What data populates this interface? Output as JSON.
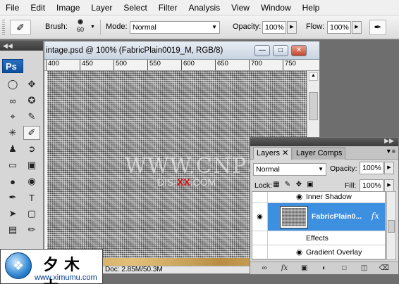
{
  "menu": [
    "File",
    "Edit",
    "Image",
    "Layer",
    "Select",
    "Filter",
    "Analysis",
    "View",
    "Window",
    "Help"
  ],
  "options": {
    "brush_label": "Brush:",
    "brush_size": "60",
    "mode_label": "Mode:",
    "mode_value": "Normal",
    "opacity_label": "Opacity:",
    "opacity_value": "100%",
    "flow_label": "Flow:",
    "flow_value": "100%"
  },
  "tools_panel": {
    "logo": "Ps"
  },
  "document": {
    "title": "intage.psd @ 100% (FabricPlain0019_M, RGB/8)",
    "ruler_ticks": [
      "400",
      "450",
      "500",
      "550",
      "600",
      "650",
      "700",
      "750"
    ],
    "status": "Doc: 2.85M/50.3M",
    "watermark_line1": "WWW.CNPS.COM",
    "watermark_line2_a": "DIS-",
    "watermark_line2_b": "XX",
    "watermark_line2_c": ".COM"
  },
  "layers_panel": {
    "tabs": [
      "Layers",
      "Layer Comps"
    ],
    "blend_mode": "Normal",
    "opacity_label": "Opacity:",
    "opacity_value": "100%",
    "lock_label": "Lock:",
    "fill_label": "Fill:",
    "fill_value": "100%",
    "rows": {
      "inner_shadow": "Inner Shadow",
      "layer_name": "FabricPlain0...",
      "effects": "Effects",
      "gradient_overlay": "Gradient Overlay"
    },
    "fx_symbol": "fx"
  },
  "logo_box": {
    "chinese": "夕木木",
    "url": "www.ximumu.com"
  },
  "colors": {
    "selection": "#3d8fe0",
    "ps_logo": "#1a5fae"
  }
}
